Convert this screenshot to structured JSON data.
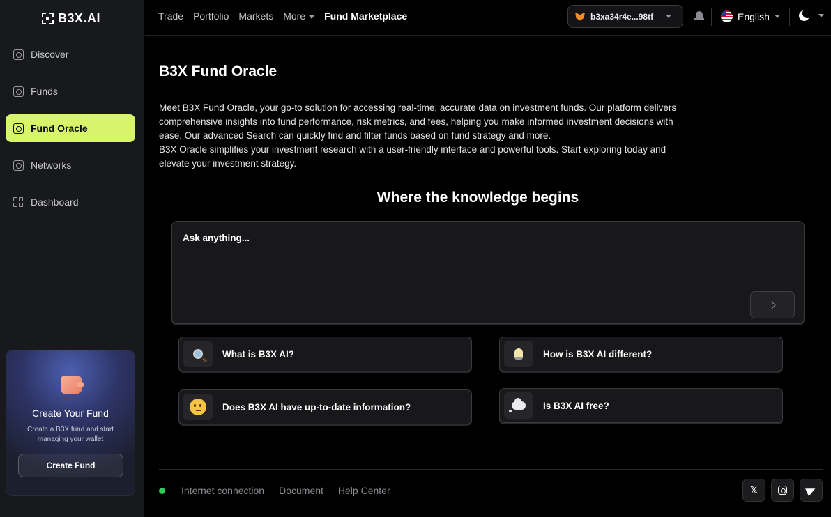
{
  "brand": {
    "name": "B3X.AI"
  },
  "sidebar": {
    "items": [
      {
        "label": "Discover",
        "icon": "discover-icon"
      },
      {
        "label": "Funds",
        "icon": "funds-icon"
      },
      {
        "label": "Fund Oracle",
        "icon": "globe-icon",
        "active": true
      },
      {
        "label": "Networks",
        "icon": "networks-icon"
      },
      {
        "label": "Dashboard",
        "icon": "dashboard-grid-icon"
      }
    ],
    "promo": {
      "title": "Create Your Fund",
      "description": "Create a B3X fund and start managing your wallet",
      "button": "Create Fund"
    }
  },
  "topbar": {
    "nav": [
      "Trade",
      "Portfolio",
      "Markets",
      "More",
      "Fund Marketplace"
    ],
    "wallet": "b3xa34r4e...98tf",
    "language": "English"
  },
  "main": {
    "title": "B3X Fund Oracle",
    "intro_p1": "Meet B3X Fund Oracle, your go-to solution for accessing real-time, accurate data on investment funds. Our platform delivers comprehensive insights into fund performance, risk metrics, and fees, helping you make informed investment decisions with ease.  Our advanced Search can quickly find and filter funds based on fund strategy and more.",
    "intro_p2": "B3X Oracle simplifies your investment research with a user-friendly interface and powerful tools. Start exploring today and elevate your investment strategy.",
    "hero": "Where the knowledge begins",
    "ask_placeholder": "Ask anything...",
    "questions": [
      {
        "label": "What is B3X AI?",
        "icon": "magnifier-emoji-icon"
      },
      {
        "label": "How is B3X AI different?",
        "icon": "lightbulb-emoji-icon"
      },
      {
        "label": "Does B3X AI have up-to-date information?",
        "icon": "thinking-face-emoji-icon"
      },
      {
        "label": "Is B3X AI free?",
        "icon": "thought-balloon-emoji-icon"
      }
    ]
  },
  "footer": {
    "status": "Internet connection",
    "status_color": "#2fc95a",
    "links": [
      "Document",
      "Help Center"
    ],
    "socials": [
      "x-icon",
      "instagram-icon",
      "telegram-icon"
    ]
  },
  "colors": {
    "accent": "#d6f56b",
    "background": "#000000",
    "sidebar": "#18191c"
  }
}
